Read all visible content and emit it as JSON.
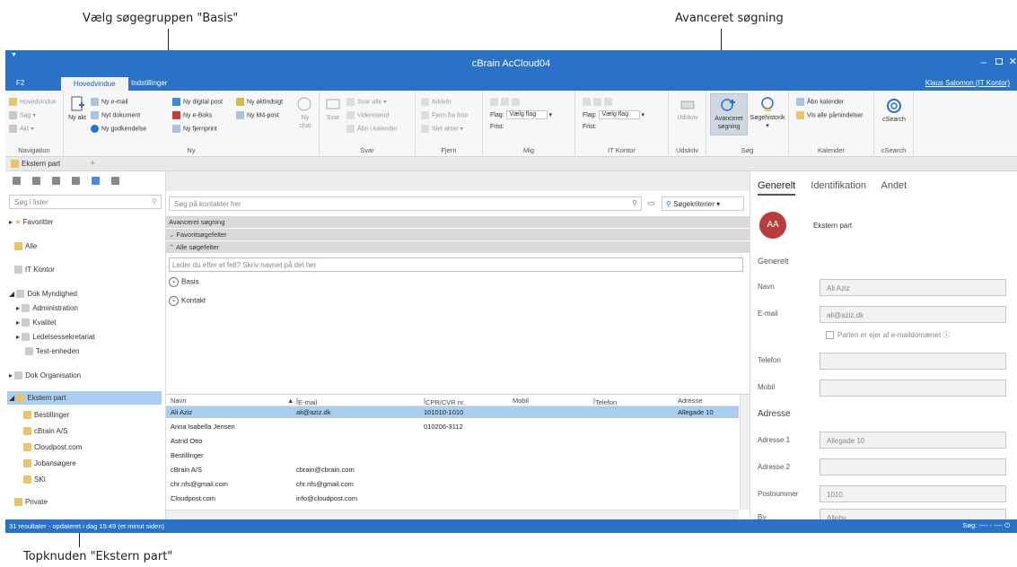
{
  "annotations": {
    "top_left": "Vælg søgegruppen \"Basis\"",
    "top_right": "Avanceret søgning",
    "bottom_left": "Topknuden \"Ekstern part\""
  },
  "window": {
    "title": "cBrain AcCloud04",
    "tabs": [
      "F2",
      "Hovedvindue",
      "Indstillinger"
    ],
    "user": "Klaus Salomon (IT Kontor)"
  },
  "ribbon": {
    "navigation": {
      "label": "Navigation",
      "items": [
        "Hovedvindue",
        "Sag",
        "Akt"
      ]
    },
    "ny": {
      "label": "Ny",
      "big": "Ny akt",
      "items": [
        "Ny e-mail",
        "Nyt dokument",
        "Ny godkendelse",
        "Ny digital post",
        "Ny e-Boks",
        "Ny fjernprint",
        "Ny aktindsigt",
        "Ny M4-post",
        "Ny chat"
      ]
    },
    "svar": {
      "label": "Svar",
      "big": "Svar",
      "items": [
        "Svar alle",
        "Videresend",
        "Åbn i kalender"
      ]
    },
    "fjern": {
      "label": "Fjern",
      "items": [
        "Arkivér",
        "Fjern fra liste",
        "Slet akter"
      ]
    },
    "mig": {
      "label": "Mig",
      "flag": "Flag:",
      "flag_value": "Vælg flag",
      "frist": "Frist:"
    },
    "itkontor": {
      "label": "IT Kontor",
      "flag": "Flag:",
      "flag_value": "Vælg flag",
      "frist": "Frist:"
    },
    "udskriv": {
      "label": "Udskriv",
      "big": "Udskriv"
    },
    "sog": {
      "label": "Søg",
      "adv": "Avanceret søgning",
      "hist": "Søgehistorik"
    },
    "kalender": {
      "label": "Kalender",
      "items": [
        "Åbn kalender",
        "Vis alle påmindelser"
      ]
    },
    "csearch": {
      "label": "cSearch",
      "big": "cSearch"
    }
  },
  "doc_tab": "Ekstern part",
  "left": {
    "search_placeholder": "Søg i lister",
    "tree": [
      "Favoritter",
      "Alle",
      "IT Kontor",
      "Dok Myndighed",
      "Administration",
      "Kvalitet",
      "Ledelsessekretariat",
      "Test-enheden",
      "Dok Organisation",
      "Ekstern part",
      "Bestillinger",
      "cBrain A/S",
      "Cloudpost.com",
      "Jobansøgere",
      "SKI",
      "Private"
    ]
  },
  "center": {
    "search_placeholder": "Søg på kontakter her",
    "criteria": "Søgekriterier",
    "groups": [
      "Avanceret søgning",
      "Favoritsøgefelter",
      "Alle søgefelter"
    ],
    "field_placeholder": "Leder du efter et felt? Skriv navnet på det her",
    "sections": [
      "Basis",
      "Kontakt"
    ],
    "columns": [
      "Navn",
      "E-mail",
      "CPR/CVR nr.",
      "Mobil",
      "Telefon",
      "Adresse"
    ],
    "rows": [
      [
        "Ali Aziz",
        "ali@aziz.dk",
        "101010-1010",
        "",
        "",
        "Allegade 10"
      ],
      [
        "Anna Isabella Jensen",
        "",
        "010206-3112",
        "",
        "",
        ""
      ],
      [
        "Astrid Otto",
        "",
        "",
        "",
        "",
        ""
      ],
      [
        "Bestillinger",
        "",
        "",
        "",
        "",
        ""
      ],
      [
        "cBrain A/S",
        "cbrain@cbrain.com",
        "",
        "",
        "",
        ""
      ],
      [
        "chr.nfs@gmail.com",
        "chr.nfs@gmail.com",
        "",
        "",
        "",
        ""
      ],
      [
        "Cloudpost.com",
        "info@cloudpost.com",
        "",
        "",
        "",
        ""
      ]
    ]
  },
  "right": {
    "tabs": [
      "Generelt",
      "Identifikation",
      "Andet"
    ],
    "avatar": "AA",
    "party_type": "Ekstern part",
    "section_general": "Generelt",
    "navn_label": "Navn",
    "navn_value": "Ali Aziz",
    "email_label": "E-mail",
    "email_value": "ali@aziz.dk",
    "domain_owner": "Parten er ejer af e-maildomænet",
    "telefon_label": "Telefon",
    "mobil_label": "Mobil",
    "section_address": "Adresse",
    "adresse1_label": "Adresse 1",
    "adresse1_value": "Allegade 10",
    "adresse2_label": "Adresse 2",
    "postnr_label": "Postnummer",
    "postnr_value": "1010",
    "by_label": "By",
    "by_value": "Alleby"
  },
  "status": {
    "left": "31 resultater - opdateret i dag 15:49 (et minut siden)",
    "right": "Søg: ---- - ----"
  },
  "colors": {
    "accent": "#2a72c8",
    "selection": "#a9cdef",
    "avatar": "#b83c3a"
  }
}
